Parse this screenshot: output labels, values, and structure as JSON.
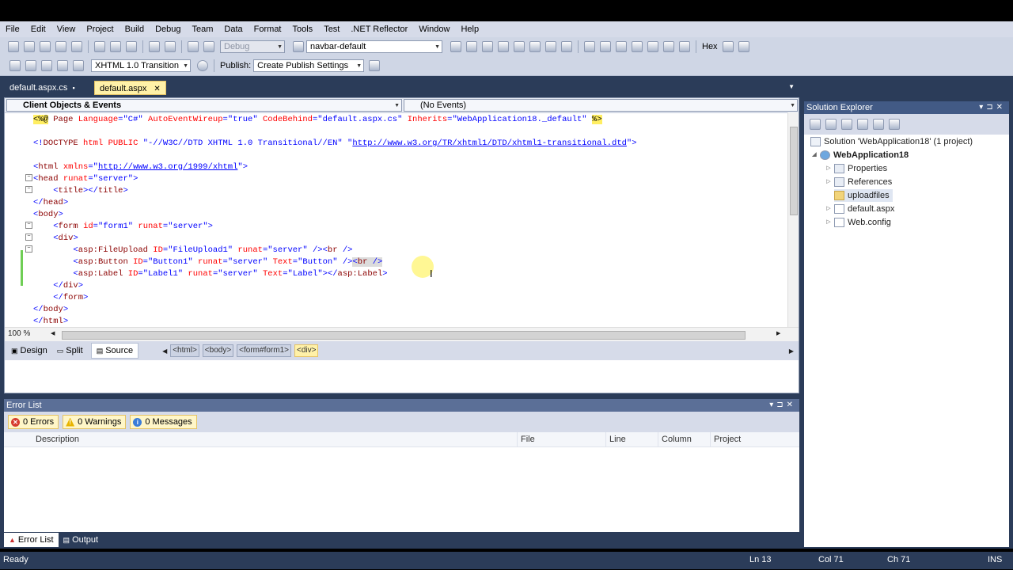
{
  "menu": [
    "File",
    "Edit",
    "View",
    "Project",
    "Build",
    "Debug",
    "Team",
    "Data",
    "Format",
    "Tools",
    "Test",
    ".NET Reflector",
    "Window",
    "Help"
  ],
  "toolbar1": {
    "config": "Debug",
    "target": "navbar-default",
    "hex": "Hex"
  },
  "toolbar2": {
    "doctype": "XHTML 1.0 Transition",
    "publish_label": "Publish:",
    "publish_value": "Create Publish Settings"
  },
  "tabs": [
    {
      "label": "default.aspx.cs"
    },
    {
      "label": "default.aspx",
      "active": true
    }
  ],
  "navbar": {
    "left": "Client Objects & Events",
    "right": "(No Events)"
  },
  "code": [
    {
      "html": "<span class='dir'>&lt;%@</span> <span class='t'>Page</span> <span class='a'>Language</span><span class='p'>=</span><span class='v'>\"C#\"</span> <span class='a'>AutoEventWireup</span><span class='p'>=</span><span class='v'>\"true\"</span> <span class='a'>CodeBehind</span><span class='p'>=</span><span class='v'>\"default.aspx.cs\"</span> <span class='a'>Inherits</span><span class='p'>=</span><span class='v'>\"WebApplication18._default\"</span> <span class='dir'>%&gt;</span>"
    },
    {
      "html": ""
    },
    {
      "html": "<span class='p'>&lt;!</span><span class='t'>DOCTYPE</span> <span class='a'>html</span> <span class='a'>PUBLIC</span> <span class='v'>\"-//W3C//DTD XHTML 1.0 Transitional//EN\"</span> <span class='v'>\"</span><span class='u'>http://www.w3.org/TR/xhtml1/DTD/xhtml1-transitional.dtd</span><span class='v'>\"</span><span class='p'>&gt;</span>"
    },
    {
      "html": ""
    },
    {
      "html": "<span class='p'>&lt;</span><span class='t'>html</span> <span class='a'>xmlns</span><span class='p'>=</span><span class='v'>\"</span><span class='u'>http://www.w3.org/1999/xhtml</span><span class='v'>\"</span><span class='p'>&gt;</span>"
    },
    {
      "html": "<span class='p'>&lt;</span><span class='t'>head</span> <span class='a'>runat</span><span class='p'>=</span><span class='v'>\"server\"</span><span class='p'>&gt;</span>"
    },
    {
      "html": "    <span class='p'>&lt;</span><span class='t'>title</span><span class='p'>&gt;&lt;/</span><span class='t'>title</span><span class='p'>&gt;</span>"
    },
    {
      "html": "<span class='p'>&lt;/</span><span class='t'>head</span><span class='p'>&gt;</span>"
    },
    {
      "html": "<span class='p'>&lt;</span><span class='t'>body</span><span class='p'>&gt;</span>"
    },
    {
      "html": "    <span class='p'>&lt;</span><span class='t'>form</span> <span class='a'>id</span><span class='p'>=</span><span class='v'>\"form1\"</span> <span class='a'>runat</span><span class='p'>=</span><span class='v'>\"server\"</span><span class='p'>&gt;</span>"
    },
    {
      "html": "    <span class='p'>&lt;</span><span class='t'>div</span><span class='p'>&gt;</span>"
    },
    {
      "html": "        <span class='p'>&lt;</span><span class='t'>asp:FileUpload</span> <span class='a'>ID</span><span class='p'>=</span><span class='v'>\"FileUpload1\"</span> <span class='a'>runat</span><span class='p'>=</span><span class='v'>\"server\"</span> <span class='p'>/&gt;&lt;</span><span class='t'>br</span> <span class='p'>/&gt;</span>"
    },
    {
      "html": "        <span class='p'>&lt;</span><span class='t'>asp:Button</span> <span class='a'>ID</span><span class='p'>=</span><span class='v'>\"Button1\"</span> <span class='a'>runat</span><span class='p'>=</span><span class='v'>\"server\"</span> <span class='a'>Text</span><span class='p'>=</span><span class='v'>\"Button\"</span> <span class='p'>/&gt;</span><span style='background:#dcdcdc'><span class='p'>&lt;</span><span class='t'>br</span> <span class='p'>/&gt;</span></span>"
    },
    {
      "html": "        <span class='p'>&lt;</span><span class='t'>asp:Label</span> <span class='a'>ID</span><span class='p'>=</span><span class='v'>\"Label1\"</span> <span class='a'>runat</span><span class='p'>=</span><span class='v'>\"server\"</span> <span class='a'>Text</span><span class='p'>=</span><span class='v'>\"Label\"</span><span class='p'>&gt;&lt;/</span><span class='t'>asp:Label</span><span class='p'>&gt;</span>"
    },
    {
      "html": "    <span class='p'>&lt;/</span><span class='t'>div</span><span class='p'>&gt;</span>"
    },
    {
      "html": "    <span class='p'>&lt;/</span><span class='t'>form</span><span class='p'>&gt;</span>"
    },
    {
      "html": "<span class='p'>&lt;/</span><span class='t'>body</span><span class='p'>&gt;</span>"
    },
    {
      "html": "<span class='p'>&lt;/</span><span class='t'>html</span><span class='p'>&gt;</span>"
    }
  ],
  "zoom": "100 %",
  "views": {
    "design": "Design",
    "split": "Split",
    "source": "Source"
  },
  "breadcrumbs": [
    "<html>",
    "<body>",
    "<form#form1>",
    "<div>"
  ],
  "error_list": {
    "title": "Error List",
    "errors": "0 Errors",
    "warnings": "0 Warnings",
    "messages": "0 Messages",
    "columns": [
      "Description",
      "File",
      "Line",
      "Column",
      "Project"
    ]
  },
  "bottom_tabs": [
    "Error List",
    "Output"
  ],
  "solution_explorer": {
    "title": "Solution Explorer",
    "nodes": [
      "Solution 'WebApplication18' (1 project)",
      "WebApplication18",
      "Properties",
      "References",
      "uploadfiles",
      "default.aspx",
      "Web.config"
    ]
  },
  "status": {
    "ready": "Ready",
    "ln": "Ln 13",
    "col": "Col 71",
    "ch": "Ch 71",
    "ins": "INS"
  }
}
